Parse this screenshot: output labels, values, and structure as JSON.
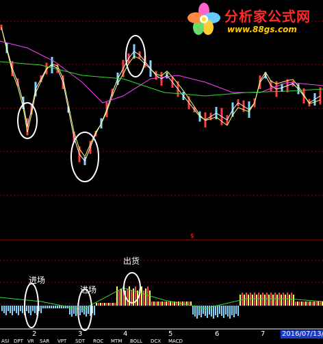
{
  "watermark": {
    "title": "分析家公式网",
    "url": "www.88gs.com",
    "flower_icon": "flower-logo-icon"
  },
  "annotations": [
    {
      "id": "entry1",
      "label": "进场"
    },
    {
      "id": "entry2",
      "label": "进场"
    },
    {
      "id": "exit",
      "label": "出货"
    }
  ],
  "middle_marker": "$",
  "x_axis_numbers": [
    "2",
    "3",
    "4",
    "5",
    "6",
    "7"
  ],
  "date": "2016/07/13/",
  "bottom_tabs": [
    "ASI",
    "DPT",
    "VR",
    "SAR",
    "VPT",
    "SDT",
    "ROC",
    "MTM",
    "BOLL",
    "DCX",
    "MACD"
  ],
  "colors": {
    "background": "#000000",
    "candle_up": "#ff3b3b",
    "candle_down": "#7fd6ff",
    "ma_fast": "#ffffff",
    "ma_mid": "#ffff66",
    "ma_slow": "#ff44ff",
    "ma_long": "#33dd33",
    "grid": "#8b0000",
    "annotation_circle": "#ffffff",
    "date_box": "#1c3cc8"
  }
}
